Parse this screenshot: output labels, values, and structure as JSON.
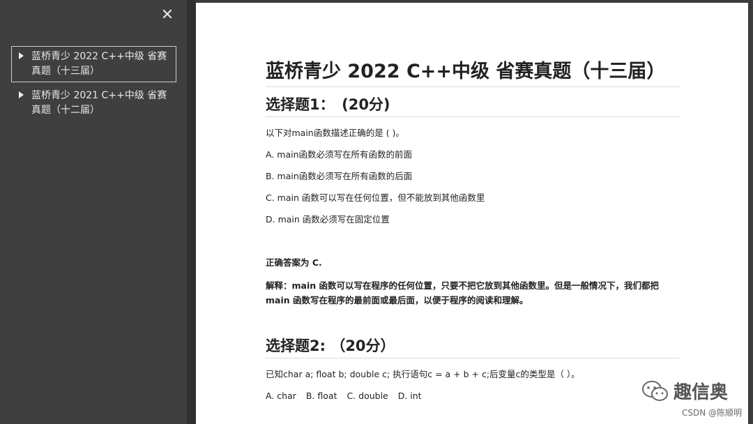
{
  "sidebar": {
    "close_label": "✕",
    "items": [
      {
        "label": "蓝桥青少 2022 C++中级 省赛真题（十三届）"
      },
      {
        "label": "蓝桥青少 2021 C++中级 省赛真题（十二届）"
      }
    ]
  },
  "document": {
    "title": "蓝桥青少 2022 C++中级 省赛真题（十三届）",
    "section1": {
      "title": "选择题1：　(20分)",
      "question": "以下对main函数描述正确的是 ( )。",
      "options": [
        "A. main函数必须写在所有函数的前面",
        "B. main函数必须写在所有函数的后面",
        "C. main 函数可以写在任何位置，但不能放到其他函数里",
        "D. main 函数必须写在固定位置"
      ],
      "answer": "正确答案为 C.",
      "explanation": "解释：main 函数可以写在程序的任何位置，只要不把它放到其他函数里。但是一般情况下，我们都把 main 函数写在程序的最前面或最后面，以便于程序的阅读和理解。"
    },
    "section2": {
      "title": "选择题2: （20分）",
      "question": "已知char a; float b; double c; 执行语句c = a + b + c;后变量c的类型是（ ）。",
      "options": [
        "A. char",
        "B. float",
        "C. double",
        "D. int"
      ]
    }
  },
  "watermark": {
    "brand": "趣信奥",
    "credit": "CSDN @陈顺明",
    "icon": "wechat-icon"
  },
  "colors": {
    "sidebar_bg": "#3f3f3f",
    "page_bg": "#ffffff",
    "text": "#222222"
  }
}
